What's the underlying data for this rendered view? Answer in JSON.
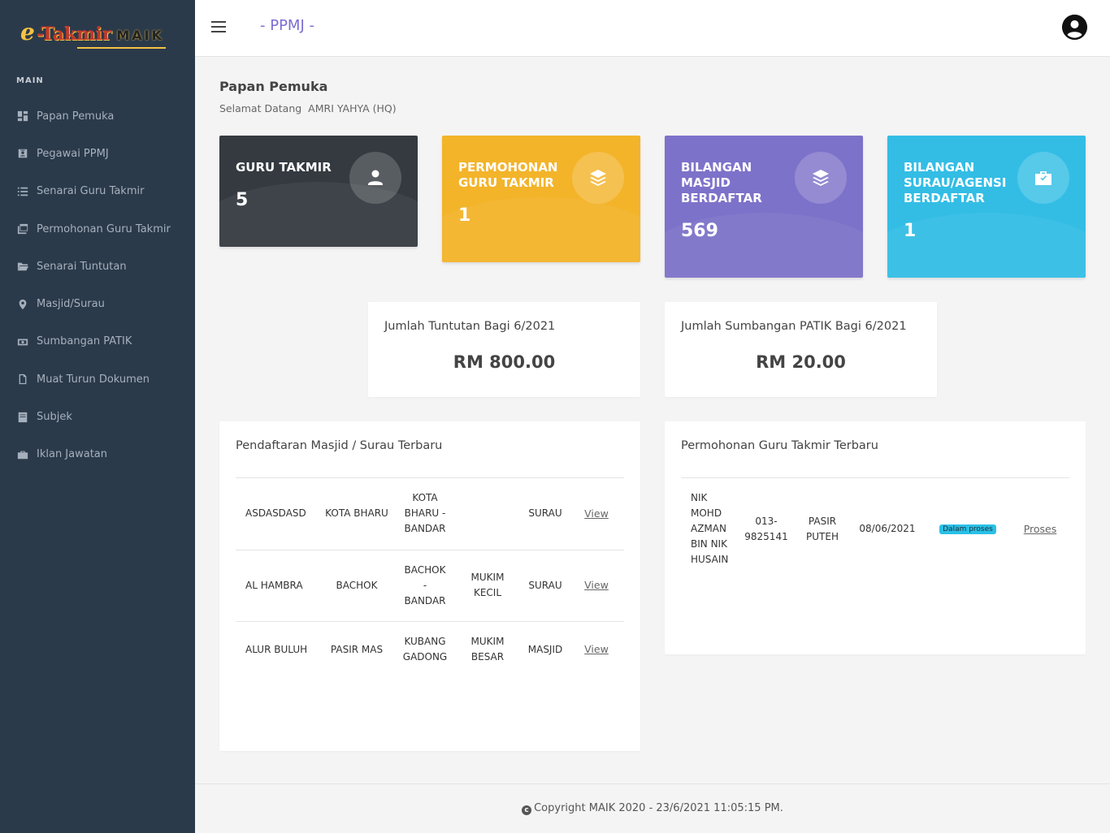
{
  "logo": {
    "e": "e",
    "takmir": "-Takmir",
    "maik": "MAIK"
  },
  "sidebar": {
    "section_title": "MAIN",
    "items": [
      {
        "label": "Papan Pemuka",
        "icon": "dashboard-icon"
      },
      {
        "label": "Pegawai PPMJ",
        "icon": "id-card-icon"
      },
      {
        "label": "Senarai Guru Takmir",
        "icon": "list-icon"
      },
      {
        "label": "Permohonan Guru Takmir",
        "icon": "windows-icon"
      },
      {
        "label": "Senarai Tuntutan",
        "icon": "folder-icon"
      },
      {
        "label": "Masjid/Surau",
        "icon": "map-pin-icon"
      },
      {
        "label": "Sumbangan PATIK",
        "icon": "money-icon"
      },
      {
        "label": "Muat Turun Dokumen",
        "icon": "document-icon"
      },
      {
        "label": "Subjek",
        "icon": "book-icon"
      },
      {
        "label": "Iklan Jawatan",
        "icon": "briefcase-icon"
      }
    ]
  },
  "topbar": {
    "brand": "- PPMJ -"
  },
  "page": {
    "title": "Papan Pemuka",
    "welcome": "Selamat Datang",
    "user": "AMRI YAHYA (HQ)"
  },
  "stats": [
    {
      "label": "GURU TAKMIR",
      "value": "5",
      "color": "#343a40",
      "icon": "user-icon"
    },
    {
      "label": "PERMOHONAN GURU TAKMIR",
      "value": "1",
      "color": "#f3b42a",
      "icon": "layers-icon"
    },
    {
      "label": "BILANGAN MASJID BERDAFTAR",
      "value": "569",
      "color": "#7d72c9",
      "icon": "layers-icon"
    },
    {
      "label": "BILANGAN SURAU/AGENSI BERDAFTAR",
      "value": "1",
      "color": "#33bde5",
      "icon": "briefcase-icon"
    }
  ],
  "summary": [
    {
      "title": "Jumlah Tuntutan Bagi 6/2021",
      "value": "RM 800.00"
    },
    {
      "title": "Jumlah Sumbangan PATIK Bagi 6/2021",
      "value": "RM 20.00"
    }
  ],
  "masjid_list": {
    "title": "Pendaftaran Masjid / Surau Terbaru",
    "rows": [
      {
        "name": "ASDASDASD",
        "daerah": "KOTA BHARU",
        "kawasan": "KOTA BHARU - BANDAR",
        "mukim": "",
        "jenis": "SURAU",
        "action": "View"
      },
      {
        "name": "AL HAMBRA",
        "daerah": "BACHOK",
        "kawasan": "BACHOK - BANDAR",
        "mukim": "MUKIM KECIL",
        "jenis": "SURAU",
        "action": "View"
      },
      {
        "name": "ALUR BULUH",
        "daerah": "PASIR MAS",
        "kawasan": "KUBANG GADONG",
        "mukim": "MUKIM BESAR",
        "jenis": "MASJID",
        "action": "View"
      }
    ]
  },
  "guru_list": {
    "title": "Permohonan Guru Takmir Terbaru",
    "rows": [
      {
        "name": "NIK MOHD AZMAN BIN NIK HUSAIN",
        "phone": "013-9825141",
        "daerah": "PASIR PUTEH",
        "date": "08/06/2021",
        "status": "Dalam proses",
        "action": "Proses"
      }
    ]
  },
  "footer": {
    "text": "Copyright MAIK 2020 - 23/6/2021 11:05:15 PM."
  }
}
